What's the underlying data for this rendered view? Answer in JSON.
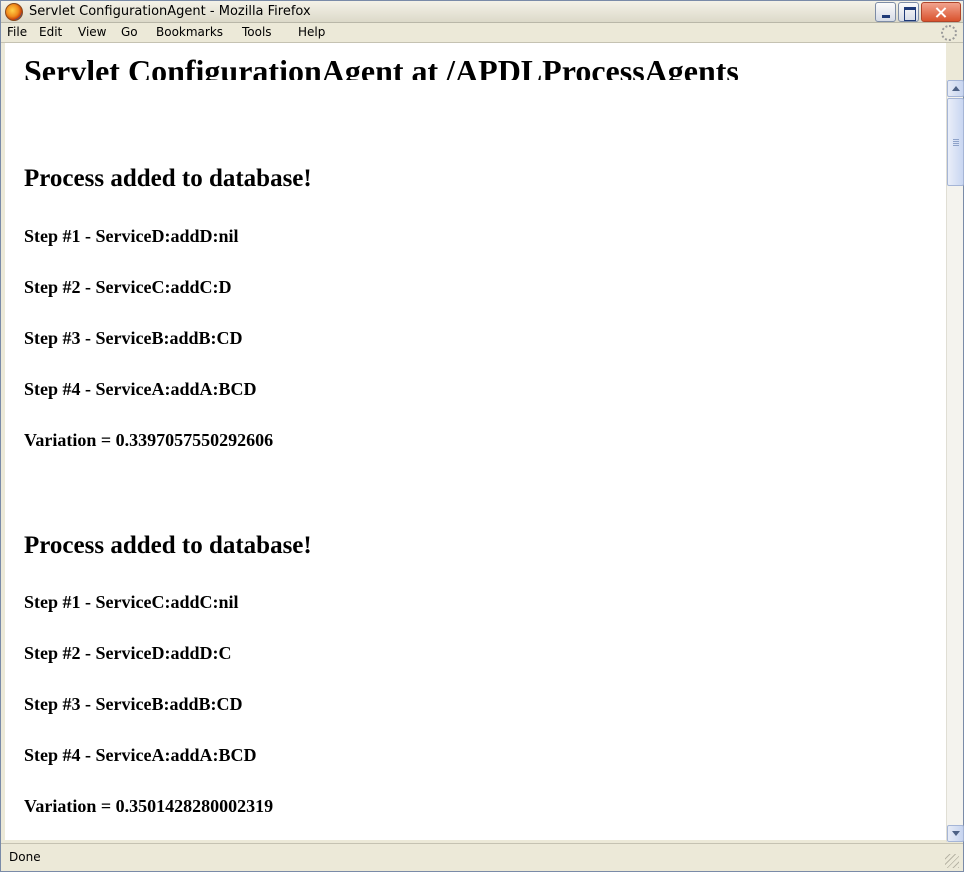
{
  "window": {
    "title": "Servlet ConfigurationAgent - Mozilla Firefox"
  },
  "menubar": {
    "items": [
      "File",
      "Edit",
      "View",
      "Go",
      "Bookmarks",
      "Tools",
      "Help"
    ]
  },
  "page": {
    "heading": "Servlet ConfigurationAgent at /APDLProcessAgents",
    "processes": [
      {
        "title": "Process added to database!",
        "steps": [
          "Step #1 - ServiceD:addD:nil",
          "Step #2 - ServiceC:addC:D",
          "Step #3 - ServiceB:addB:CD",
          "Step #4 - ServiceA:addA:BCD"
        ],
        "variation": "Variation = 0.3397057550292606"
      },
      {
        "title": "Process added to database!",
        "steps": [
          "Step #1 - ServiceC:addC:nil",
          "Step #2 - ServiceD:addD:C",
          "Step #3 - ServiceB:addB:CD",
          "Step #4 - ServiceA:addA:BCD"
        ],
        "variation": "Variation = 0.3501428280002319"
      }
    ]
  },
  "statusbar": {
    "text": "Done"
  },
  "icons": {
    "app": "firefox-icon",
    "throbber": "throbber-icon"
  }
}
